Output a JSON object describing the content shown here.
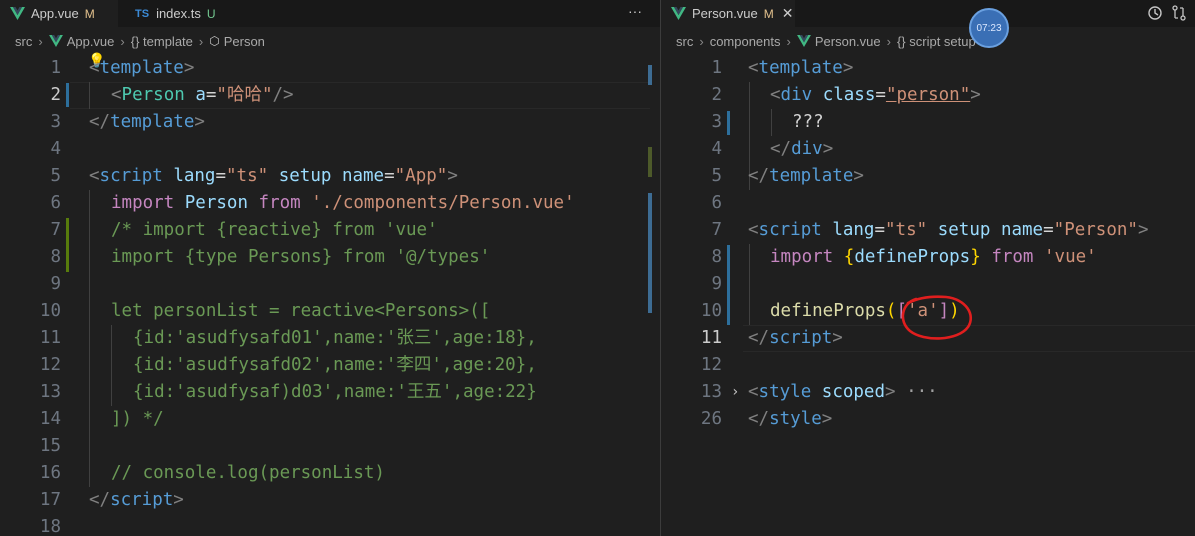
{
  "left": {
    "tabs": [
      {
        "icon": "vue",
        "name": "App.vue",
        "status": "M"
      },
      {
        "icon": "ts",
        "name": "index.ts",
        "status": "U"
      }
    ],
    "more_label": "···",
    "breadcrumb": [
      "src",
      "App.vue",
      "{} template",
      "Person"
    ],
    "line_numbers": [
      "1",
      "2",
      "3",
      "4",
      "5",
      "6",
      "7",
      "8",
      "9",
      "10",
      "11",
      "12",
      "13",
      "14",
      "15",
      "16",
      "17",
      "18"
    ]
  },
  "right": {
    "tab": {
      "name": "Person.vue",
      "status": "M",
      "close": "✕"
    },
    "timer": "07:23",
    "breadcrumb": [
      "src",
      "components",
      "Person.vue",
      "{} script setup"
    ],
    "line_numbers": [
      "1",
      "2",
      "3",
      "4",
      "5",
      "6",
      "7",
      "8",
      "9",
      "10",
      "11",
      "12",
      "13",
      "26"
    ]
  },
  "colors": {
    "accent_modified": "#e2c08d",
    "accent_untracked": "#73c991",
    "annotation": "#e01e1e"
  }
}
